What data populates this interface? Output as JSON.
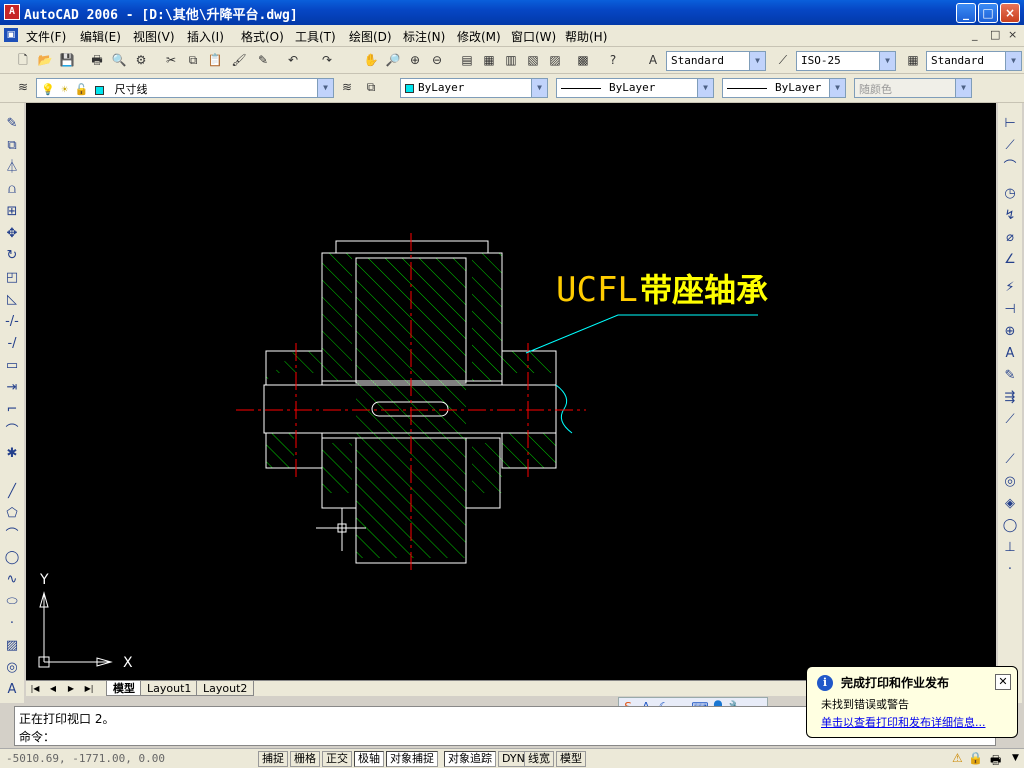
{
  "window": {
    "title": "AutoCAD 2006 - [D:\\其他\\升降平台.dwg]",
    "controls": [
      "_",
      "□",
      "×"
    ]
  },
  "menu": {
    "items": [
      "文件(F)",
      "编辑(E)",
      "视图(V)",
      "插入(I)",
      "格式(O)",
      "工具(T)",
      "绘图(D)",
      "标注(N)",
      "修改(M)",
      "窗口(W)",
      "帮助(H)"
    ],
    "mdi_controls": [
      "_",
      "□",
      "×"
    ]
  },
  "styles_toolbar": {
    "text_style": "Standard",
    "dim_style": "ISO-25",
    "table_style": "Standard"
  },
  "layers_toolbar": {
    "current_layer": "尺寸线",
    "color": "ByLayer",
    "linetype": "ByLayer",
    "lineweight": "ByLayer",
    "plot_style": "随颜色"
  },
  "drawing": {
    "annotation_prefix": "UCFL",
    "annotation_suffix": "带座轴承",
    "ucs_x": "X",
    "ucs_y": "Y"
  },
  "layout_tabs": [
    "模型",
    "Layout1",
    "Layout2"
  ],
  "command": {
    "history": "正在打印视口 2。",
    "prompt": "命令："
  },
  "status": {
    "coordinates": "-5010.69, -1771.00, 0.00",
    "toggles": [
      "捕捉",
      "栅格",
      "正交",
      "极轴",
      "对象捕捉",
      "对象追踪",
      "DYN",
      "线宽",
      "模型"
    ]
  },
  "notification": {
    "title": "完成打印和作业发布",
    "message": "未找到错误或警告",
    "link": "单击以查看打印和发布详细信息..."
  },
  "colors": {
    "annotation_prefix": "#ffcc00",
    "annotation_suffix": "#ffff00",
    "outline": "#ffffff",
    "hatch": "#00cc00",
    "centerline": "#ff0000",
    "leader": "#00ffff"
  },
  "icons": {
    "app": "autocad-logo-icon",
    "ime": [
      "sogou-s-icon",
      "letter-a-icon",
      "moon-icon",
      "comma-icon",
      "keyboard-icon",
      "user-icon",
      "wrench-icon"
    ]
  }
}
